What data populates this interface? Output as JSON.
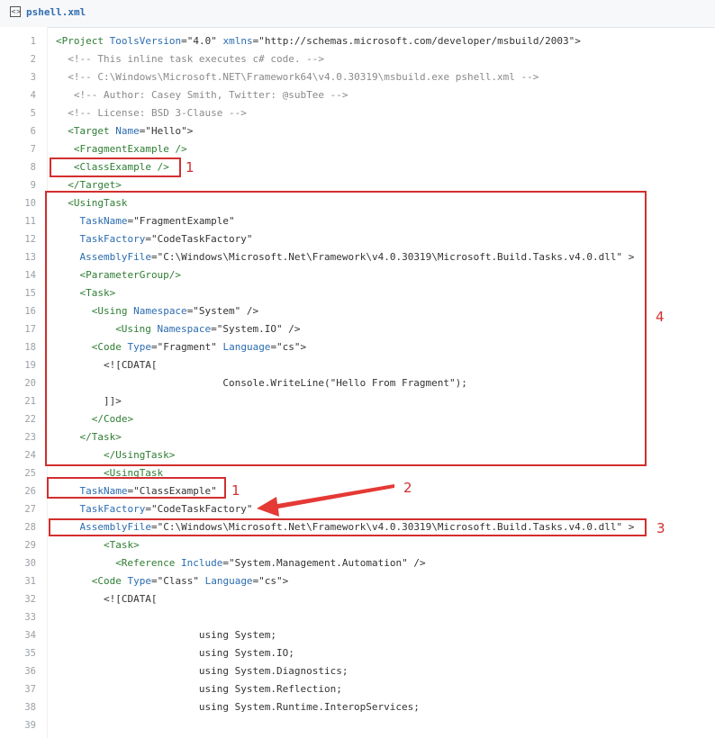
{
  "file": {
    "icon": "code-file-icon",
    "name": "pshell.xml"
  },
  "lines": [
    {
      "n": "1",
      "indent": 0,
      "parts": [
        [
          "t-tag",
          "<Project "
        ],
        [
          "t-attr",
          "ToolsVersion"
        ],
        [
          "t-val",
          "=\"4.0\" "
        ],
        [
          "t-attr",
          "xmlns"
        ],
        [
          "t-val",
          "=\"http://schemas.microsoft.com/developer/msbuild/2003\">"
        ]
      ]
    },
    {
      "n": "2",
      "indent": 2,
      "parts": [
        [
          "t-com",
          "<!-- This inline task executes c# code. -->"
        ]
      ]
    },
    {
      "n": "3",
      "indent": 2,
      "parts": [
        [
          "t-com",
          "<!-- C:\\Windows\\Microsoft.NET\\Framework64\\v4.0.30319\\msbuild.exe pshell.xml -->"
        ]
      ]
    },
    {
      "n": "4",
      "indent": 3,
      "parts": [
        [
          "t-com",
          "<!-- Author: Casey Smith, Twitter: @subTee -->"
        ]
      ]
    },
    {
      "n": "5",
      "indent": 2,
      "parts": [
        [
          "t-com",
          "<!-- License: BSD 3-Clause -->"
        ]
      ]
    },
    {
      "n": "6",
      "indent": 2,
      "parts": [
        [
          "t-tag",
          "<Target "
        ],
        [
          "t-attr",
          "Name"
        ],
        [
          "t-val",
          "=\"Hello\">"
        ]
      ]
    },
    {
      "n": "7",
      "indent": 3,
      "parts": [
        [
          "t-tag",
          "<FragmentExample />"
        ]
      ]
    },
    {
      "n": "8",
      "indent": 3,
      "parts": [
        [
          "t-tag",
          "<ClassExample />"
        ]
      ]
    },
    {
      "n": "9",
      "indent": 2,
      "parts": [
        [
          "t-tag",
          "</Target>"
        ]
      ]
    },
    {
      "n": "10",
      "indent": 2,
      "parts": [
        [
          "t-tag",
          "<UsingTask"
        ]
      ]
    },
    {
      "n": "11",
      "indent": 4,
      "parts": [
        [
          "t-attr",
          "TaskName"
        ],
        [
          "t-val",
          "=\"FragmentExample\""
        ]
      ]
    },
    {
      "n": "12",
      "indent": 4,
      "parts": [
        [
          "t-attr",
          "TaskFactory"
        ],
        [
          "t-val",
          "=\"CodeTaskFactory\""
        ]
      ]
    },
    {
      "n": "13",
      "indent": 4,
      "parts": [
        [
          "t-attr",
          "AssemblyFile"
        ],
        [
          "t-val",
          "=\"C:\\Windows\\Microsoft.Net\\Framework\\v4.0.30319\\Microsoft.Build.Tasks.v4.0.dll\" >"
        ]
      ]
    },
    {
      "n": "14",
      "indent": 4,
      "parts": [
        [
          "t-tag",
          "<ParameterGroup/>"
        ]
      ]
    },
    {
      "n": "15",
      "indent": 4,
      "parts": [
        [
          "t-tag",
          "<Task>"
        ]
      ]
    },
    {
      "n": "16",
      "indent": 6,
      "parts": [
        [
          "t-tag",
          "<Using "
        ],
        [
          "t-attr",
          "Namespace"
        ],
        [
          "t-val",
          "=\"System\" />"
        ]
      ]
    },
    {
      "n": "17",
      "indent": 10,
      "parts": [
        [
          "t-tag",
          "<Using "
        ],
        [
          "t-attr",
          "Namespace"
        ],
        [
          "t-val",
          "=\"System.IO\" />"
        ]
      ]
    },
    {
      "n": "18",
      "indent": 6,
      "parts": [
        [
          "t-tag",
          "<Code "
        ],
        [
          "t-attr",
          "Type"
        ],
        [
          "t-val",
          "=\"Fragment\" "
        ],
        [
          "t-attr",
          "Language"
        ],
        [
          "t-val",
          "=\"cs\">"
        ]
      ]
    },
    {
      "n": "19",
      "indent": 8,
      "parts": [
        [
          "t-val",
          "<![CDATA["
        ]
      ]
    },
    {
      "n": "20",
      "indent": 28,
      "parts": [
        [
          "t-val",
          "Console.WriteLine(\"Hello From Fragment\");"
        ]
      ]
    },
    {
      "n": "21",
      "indent": 8,
      "parts": [
        [
          "t-val",
          "]]>"
        ]
      ]
    },
    {
      "n": "22",
      "indent": 6,
      "parts": [
        [
          "t-tag",
          "</Code>"
        ]
      ]
    },
    {
      "n": "23",
      "indent": 4,
      "parts": [
        [
          "t-tag",
          "</Task>"
        ]
      ]
    },
    {
      "n": "24",
      "indent": 8,
      "parts": [
        [
          "t-tag",
          "</UsingTask>"
        ]
      ]
    },
    {
      "n": "25",
      "indent": 8,
      "parts": [
        [
          "t-tag",
          "<UsingTask"
        ]
      ]
    },
    {
      "n": "26",
      "indent": 4,
      "parts": [
        [
          "t-attr",
          "TaskName"
        ],
        [
          "t-val",
          "=\"ClassExample\""
        ]
      ]
    },
    {
      "n": "27",
      "indent": 4,
      "parts": [
        [
          "t-attr",
          "TaskFactory"
        ],
        [
          "t-val",
          "=\"CodeTaskFactory\""
        ]
      ]
    },
    {
      "n": "28",
      "indent": 4,
      "parts": [
        [
          "t-attr",
          "AssemblyFile"
        ],
        [
          "t-val",
          "=\"C:\\Windows\\Microsoft.Net\\Framework\\v4.0.30319\\Microsoft.Build.Tasks.v4.0.dll\" >"
        ]
      ]
    },
    {
      "n": "29",
      "indent": 8,
      "parts": [
        [
          "t-tag",
          "<Task>"
        ]
      ]
    },
    {
      "n": "30",
      "indent": 10,
      "parts": [
        [
          "t-tag",
          "<Reference "
        ],
        [
          "t-attr",
          "Include"
        ],
        [
          "t-val",
          "=\"System.Management.Automation\" />"
        ]
      ]
    },
    {
      "n": "31",
      "indent": 6,
      "parts": [
        [
          "t-tag",
          "<Code "
        ],
        [
          "t-attr",
          "Type"
        ],
        [
          "t-val",
          "=\"Class\" "
        ],
        [
          "t-attr",
          "Language"
        ],
        [
          "t-val",
          "=\"cs\">"
        ]
      ]
    },
    {
      "n": "32",
      "indent": 8,
      "parts": [
        [
          "t-val",
          "<![CDATA["
        ]
      ]
    },
    {
      "n": "33",
      "indent": 0,
      "parts": []
    },
    {
      "n": "34",
      "indent": 24,
      "parts": [
        [
          "t-val",
          "using System;"
        ]
      ]
    },
    {
      "n": "35",
      "indent": 24,
      "parts": [
        [
          "t-val",
          "using System.IO;"
        ]
      ]
    },
    {
      "n": "36",
      "indent": 24,
      "parts": [
        [
          "t-val",
          "using System.Diagnostics;"
        ]
      ]
    },
    {
      "n": "37",
      "indent": 24,
      "parts": [
        [
          "t-val",
          "using System.Reflection;"
        ]
      ]
    },
    {
      "n": "38",
      "indent": 24,
      "parts": [
        [
          "t-val",
          "using System.Runtime.InteropServices;"
        ]
      ]
    },
    {
      "n": "39",
      "indent": 0,
      "parts": []
    }
  ],
  "annotations": {
    "label_1a": "1",
    "label_1b": "1",
    "label_2": "2",
    "label_3": "3",
    "label_4": "4"
  }
}
